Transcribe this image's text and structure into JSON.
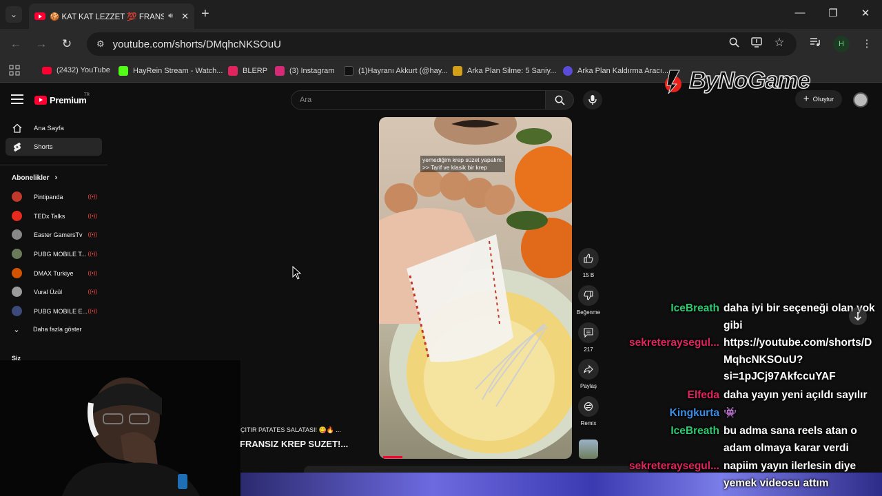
{
  "browser": {
    "tab_title": "🍪 KAT KAT LEZZET 💯 FRANSIZ",
    "url": "youtube.com/shorts/DMqhcNKSOuU",
    "profile_initial": "H",
    "bookmarks": [
      {
        "label": "(2432) YouTube",
        "color": "#ff0033"
      },
      {
        "label": "HayRein Stream - Watch...",
        "color": "#53fc18"
      },
      {
        "label": "BLERP",
        "color": "#e0245e"
      },
      {
        "label": "(3) Instagram",
        "color": "#d62976"
      },
      {
        "label": "(1)Hayranı Akkurt (@hay...",
        "color": "#111111"
      },
      {
        "label": "Arka Plan Silme: 5 Saniy...",
        "color": "#d4a017"
      },
      {
        "label": "Arka Plan Kaldırma Aracı...",
        "color": "#5b4bdb"
      }
    ]
  },
  "watermark": {
    "text": "ByNoGame"
  },
  "youtube": {
    "logo_text": "Premium",
    "logo_superscript": "TR",
    "search_placeholder": "Ara",
    "create_label": "Oluştur",
    "sidebar": {
      "items": [
        {
          "label": "Ana Sayfa",
          "icon": "home-icon"
        },
        {
          "label": "Shorts",
          "icon": "shorts-icon",
          "active": true
        }
      ],
      "subscriptions_heading": "Abonelikler",
      "subscriptions": [
        {
          "label": "Pintipanda",
          "color": "#c0392b"
        },
        {
          "label": "TEDx Talks",
          "color": "#e62b1e"
        },
        {
          "label": "Easter GamersTv",
          "color": "#888888"
        },
        {
          "label": "PUBG MOBILE T...",
          "color": "#6b7a5a"
        },
        {
          "label": "DMAX Turkiye",
          "color": "#d35400"
        },
        {
          "label": "Vural Üzül",
          "color": "#9a9a9a"
        },
        {
          "label": "PUBG MOBILE E...",
          "color": "#3b4a7a"
        }
      ],
      "show_more": "Daha fazla göster",
      "you_heading": "Siz"
    },
    "short": {
      "caption_line1": "yemediğim krep süzet yapalım.",
      "caption_line2": ">> Tarif ve klasik bir krep",
      "likes": "15 B",
      "dislike_label": "Beğenme",
      "comments": "217",
      "share_label": "Paylaş",
      "remix_label": "Remix"
    },
    "side_titles": {
      "line1": "ÇITIR PATATES SALATASI! 😋🔥 ...",
      "line2": "FRANSIZ KREP SUZET!..."
    }
  },
  "chat": {
    "messages": [
      {
        "user": "IceBreath",
        "color": "#2ecc71",
        "lines": [
          "daha iyi bir seçeneği olan yok",
          "gibi"
        ]
      },
      {
        "user": "sekreteraysegul...",
        "color": "#e0245e",
        "lines": [
          "https://youtube.com/shorts/D",
          "MqhcNKSOuU?",
          "si=1pJCj97AkfccuYAF"
        ]
      },
      {
        "user": "Elfeda",
        "color": "#e0245e",
        "lines": [
          "daha yayın yeni açıldı sayılır"
        ]
      },
      {
        "user": "Kingkurta",
        "color": "#3a8ee6",
        "lines": [
          "👾"
        ]
      },
      {
        "user": "IceBreath",
        "color": "#2ecc71",
        "lines": [
          "bu adma sana reels atan o",
          "adam olmaya karar verdi"
        ]
      },
      {
        "user": "sekreteraysegul...",
        "color": "#e0245e",
        "lines": [
          "napiim yayın ilerlesin diye",
          "yemek videosu attım"
        ]
      }
    ]
  }
}
